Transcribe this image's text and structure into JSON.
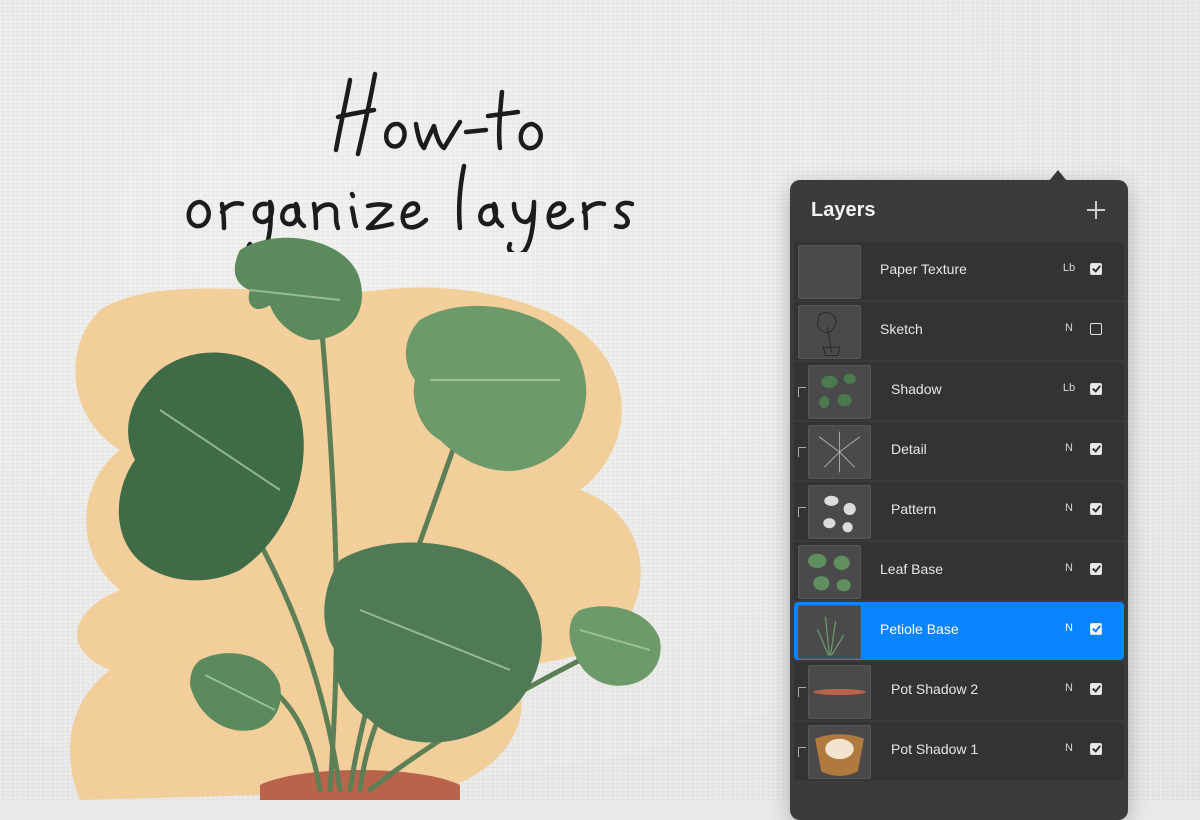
{
  "title_art": "How-to organize layers",
  "panel": {
    "title": "Layers",
    "add_label": "+"
  },
  "layers": [
    {
      "name": "Paper Texture",
      "blend": "Lb",
      "visible": true,
      "clipped": false,
      "selected": false
    },
    {
      "name": "Sketch",
      "blend": "N",
      "visible": false,
      "clipped": false,
      "selected": false
    },
    {
      "name": "Shadow",
      "blend": "Lb",
      "visible": true,
      "clipped": true,
      "selected": false
    },
    {
      "name": "Detail",
      "blend": "N",
      "visible": true,
      "clipped": true,
      "selected": false
    },
    {
      "name": "Pattern",
      "blend": "N",
      "visible": true,
      "clipped": true,
      "selected": false
    },
    {
      "name": "Leaf Base",
      "blend": "N",
      "visible": true,
      "clipped": false,
      "selected": false
    },
    {
      "name": "Petiole Base",
      "blend": "N",
      "visible": true,
      "clipped": false,
      "selected": true
    },
    {
      "name": "Pot Shadow 2",
      "blend": "N",
      "visible": true,
      "clipped": true,
      "selected": false
    },
    {
      "name": "Pot Shadow 1",
      "blend": "N",
      "visible": true,
      "clipped": true,
      "selected": false
    }
  ],
  "colors": {
    "panel_bg": "#3b3b3d",
    "selected": "#0a84ff",
    "leaf": "#4f7a55",
    "wash": "#f3c98d",
    "pot": "#b9634a"
  }
}
